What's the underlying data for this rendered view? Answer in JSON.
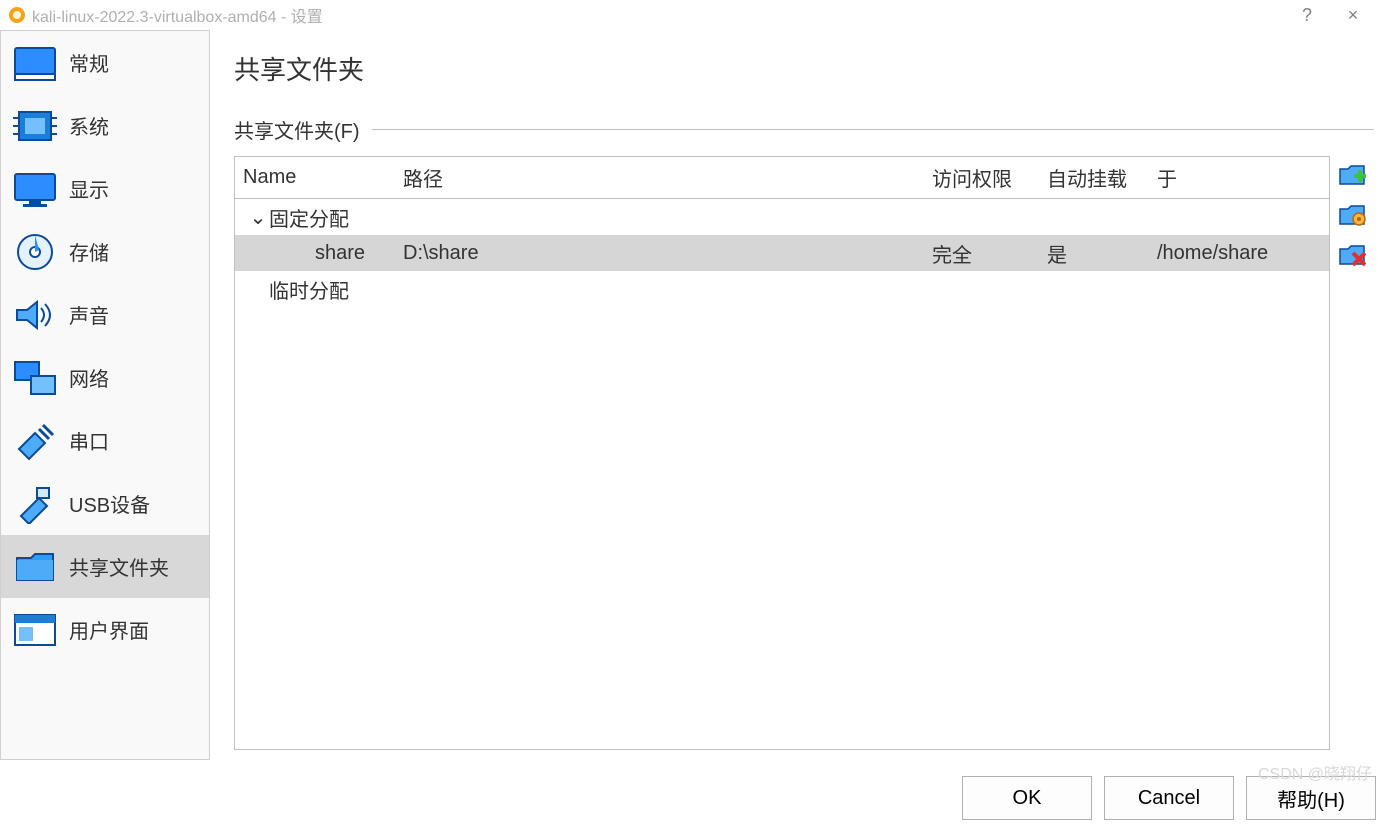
{
  "titlebar": {
    "text": "kali-linux-2022.3-virtualbox-amd64 - 设置",
    "help_btn": "?",
    "close_btn": "×"
  },
  "sidebar": {
    "items": [
      {
        "label": "常规"
      },
      {
        "label": "系统"
      },
      {
        "label": "显示"
      },
      {
        "label": "存储"
      },
      {
        "label": "声音"
      },
      {
        "label": "网络"
      },
      {
        "label": "串口"
      },
      {
        "label": "USB设备"
      },
      {
        "label": "共享文件夹"
      },
      {
        "label": "用户界面"
      }
    ]
  },
  "page": {
    "title": "共享文件夹",
    "section_label": "共享文件夹(F)"
  },
  "table": {
    "columns": {
      "name": "Name",
      "path": "路径",
      "access": "访问权限",
      "automount": "自动挂载",
      "at": "于"
    },
    "groups": [
      {
        "label": "固定分配",
        "expanded": true,
        "rows": [
          {
            "name": "share",
            "path": "D:\\share",
            "access": "完全",
            "automount": "是",
            "at": "/home/share"
          }
        ]
      },
      {
        "label": "临时分配",
        "expanded": true,
        "rows": []
      }
    ]
  },
  "buttons": {
    "ok": "OK",
    "cancel": "Cancel",
    "help": "帮助(H)"
  },
  "watermark": "CSDN @晓翔仔"
}
